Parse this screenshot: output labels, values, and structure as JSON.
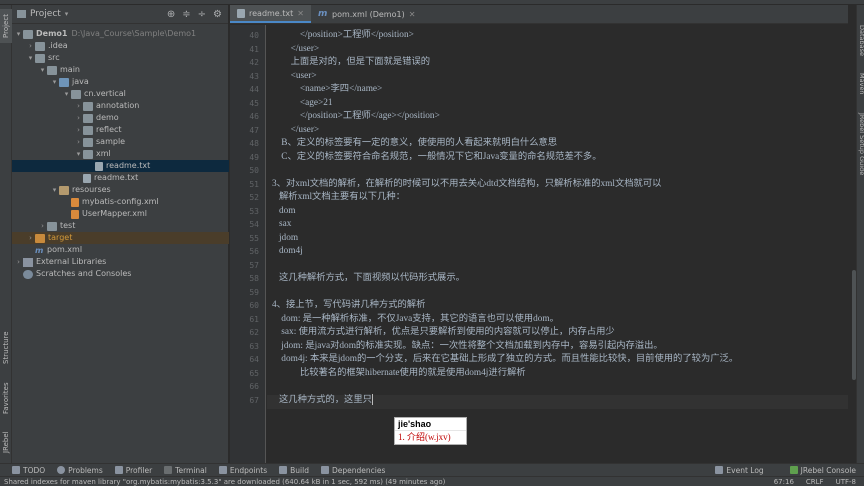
{
  "left_tabs": [
    "Project",
    "Structure",
    "Favorites",
    "JRebel"
  ],
  "project_panel": {
    "title": "Project",
    "tree": [
      {
        "label": "Demo1",
        "hint": "D:\\Java_Course\\Sample\\Demo1",
        "icon": "folder",
        "bold": true
      },
      {
        "label": ".idea",
        "icon": "folder"
      },
      {
        "label": "src",
        "icon": "folder"
      },
      {
        "label": "main",
        "icon": "folder"
      },
      {
        "label": "java",
        "icon": "folder-blue"
      },
      {
        "label": "cn.vertical",
        "icon": "package"
      },
      {
        "label": "annotation",
        "icon": "package"
      },
      {
        "label": "demo",
        "icon": "package"
      },
      {
        "label": "reflect",
        "icon": "package"
      },
      {
        "label": "sample",
        "icon": "package"
      },
      {
        "label": "xml",
        "icon": "package"
      },
      {
        "label": "readme.txt",
        "icon": "text-file"
      },
      {
        "label": "readme.txt",
        "icon": "text-file"
      },
      {
        "label": "resourses",
        "icon": "folder-tan"
      },
      {
        "label": "mybatis-config.xml",
        "icon": "xml-file"
      },
      {
        "label": "UserMapper.xml",
        "icon": "xml-file"
      },
      {
        "label": "test",
        "icon": "folder"
      },
      {
        "label": "target",
        "icon": "folder-orange"
      },
      {
        "label": "pom.xml",
        "icon": "maven-icon"
      },
      {
        "label": "External Libraries",
        "icon": "library"
      },
      {
        "label": "Scratches and Consoles",
        "icon": "scratch"
      }
    ]
  },
  "tabs": [
    {
      "label": "readme.txt",
      "active": true
    },
    {
      "label": "pom.xml (Demo1)",
      "active": false
    }
  ],
  "editor": {
    "lines": [
      {
        "num": "40",
        "text": "            </position>工程师</position>"
      },
      {
        "num": "41",
        "text": "        </user>"
      },
      {
        "num": "42",
        "text": "        上面是对的，但是下面就是错误的"
      },
      {
        "num": "43",
        "text": "        <user>"
      },
      {
        "num": "44",
        "text": "            <name>李四</name>"
      },
      {
        "num": "45",
        "text": "            <age>21"
      },
      {
        "num": "46",
        "text": "            </position>工程师</age></position>"
      },
      {
        "num": "47",
        "text": "        </user>"
      },
      {
        "num": "48",
        "text": "    B、定义的标签要有一定的意义，使使用的人看起来就明白什么意思"
      },
      {
        "num": "49",
        "text": "    C、定义的标签要符合命名规范，一般情况下它和Java变量的命名规范差不多。"
      },
      {
        "num": "50",
        "text": ""
      },
      {
        "num": "51",
        "text": "3、对xml文档的解析，在解析的时候可以不用去关心dtd文档结构，只解析标准的xml文档就可以"
      },
      {
        "num": "52",
        "text": "   解析xml文档主要有以下几种："
      },
      {
        "num": "53",
        "text": "   dom"
      },
      {
        "num": "54",
        "text": "   sax"
      },
      {
        "num": "55",
        "text": "   jdom"
      },
      {
        "num": "56",
        "text": "   dom4j"
      },
      {
        "num": "57",
        "text": ""
      },
      {
        "num": "58",
        "text": "   这几种解析方式，下面视频以代码形式展示。"
      },
      {
        "num": "59",
        "text": ""
      },
      {
        "num": "60",
        "text": "4、接上节，写代码讲几种方式的解析"
      },
      {
        "num": "61",
        "text": "    dom: 是一种解析标准，不仅Java支持，其它的语言也可以使用dom。"
      },
      {
        "num": "62",
        "text": "    sax: 使用流方式进行解析，优点是只要解析到使用的内容就可以停止，内存占用少"
      },
      {
        "num": "63",
        "text": "    jdom: 是java对dom的标准实现。缺点：一次性将整个文档加载到内存中，容易引起内存溢出。"
      },
      {
        "num": "64",
        "text": "    dom4j: 本来是jdom的一个分支，后来在它基础上形成了独立的方式。而且性能比较快，目前使用的了较为广泛。"
      },
      {
        "num": "65",
        "text": "            比较著名的框架hibernate使用的就是使用dom4j进行解析"
      },
      {
        "num": "66",
        "text": ""
      },
      {
        "num": "67",
        "text": "   这几种方式的，这里只"
      }
    ]
  },
  "ime": {
    "composition": "jie'shao",
    "candidate": "1. 介绍(w.jxv)"
  },
  "right_tabs": [
    "Database",
    "Maven",
    "JRebel Setup Guide"
  ],
  "bottom_tools": [
    "TODO",
    "Problems",
    "Profiler",
    "Terminal",
    "Endpoints",
    "Build",
    "Dependencies"
  ],
  "bottom_right": [
    "Event Log",
    "JRebel Console"
  ],
  "status": {
    "message": "Shared indexes for maven library \"org.mybatis:mybatis:3.5.3\" are downloaded (640.64 kB in 1 sec, 592 ms) (49 minutes ago)",
    "position": "67:16",
    "line_sep": "CRLF",
    "encoding": "UTF-8"
  }
}
